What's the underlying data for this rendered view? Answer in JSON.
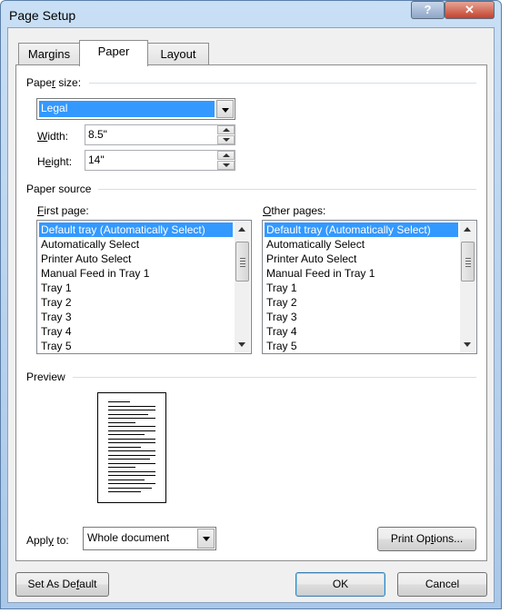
{
  "window": {
    "title": "Page Setup",
    "help_icon": "?",
    "close_icon": "✕"
  },
  "tabs": [
    {
      "label": "Margins",
      "active": false
    },
    {
      "label": "Paper",
      "active": true
    },
    {
      "label": "Layout",
      "active": false
    }
  ],
  "paper_size": {
    "label_pre": "Pape",
    "label_key": "r",
    "label_post": " size:",
    "selected": "Legal",
    "width_label_key": "W",
    "width_label_post": "idth:",
    "width_value": "8.5\"",
    "height_label_pre": "H",
    "height_label_key": "e",
    "height_label_post": "ight:",
    "height_value": "14\""
  },
  "paper_source": {
    "label": "Paper source",
    "first_page_label_key": "F",
    "first_page_label_post": "irst page:",
    "other_pages_label_key": "O",
    "other_pages_label_post": "ther pages:",
    "options": [
      "Default tray (Automatically Select)",
      "Automatically Select",
      "Printer Auto Select",
      "Manual Feed in Tray 1",
      "Tray 1",
      "Tray 2",
      "Tray 3",
      "Tray 4",
      "Tray 5"
    ],
    "first_selected": "Default tray (Automatically Select)",
    "other_selected": "Default tray (Automatically Select)"
  },
  "preview": {
    "label": "Preview"
  },
  "apply_to": {
    "label_pre": "Appl",
    "label_key": "y",
    "label_post": " to:",
    "selected": "Whole document"
  },
  "buttons": {
    "print_options_pre": "Print Op",
    "print_options_key": "t",
    "print_options_post": "ions...",
    "set_default_pre": "Set As De",
    "set_default_key": "f",
    "set_default_post": "ault",
    "ok": "OK",
    "cancel": "Cancel"
  },
  "colors": {
    "selection": "#3399ff",
    "dialog_bg": "#f0f0f0",
    "panel_bg": "#ffffff"
  }
}
